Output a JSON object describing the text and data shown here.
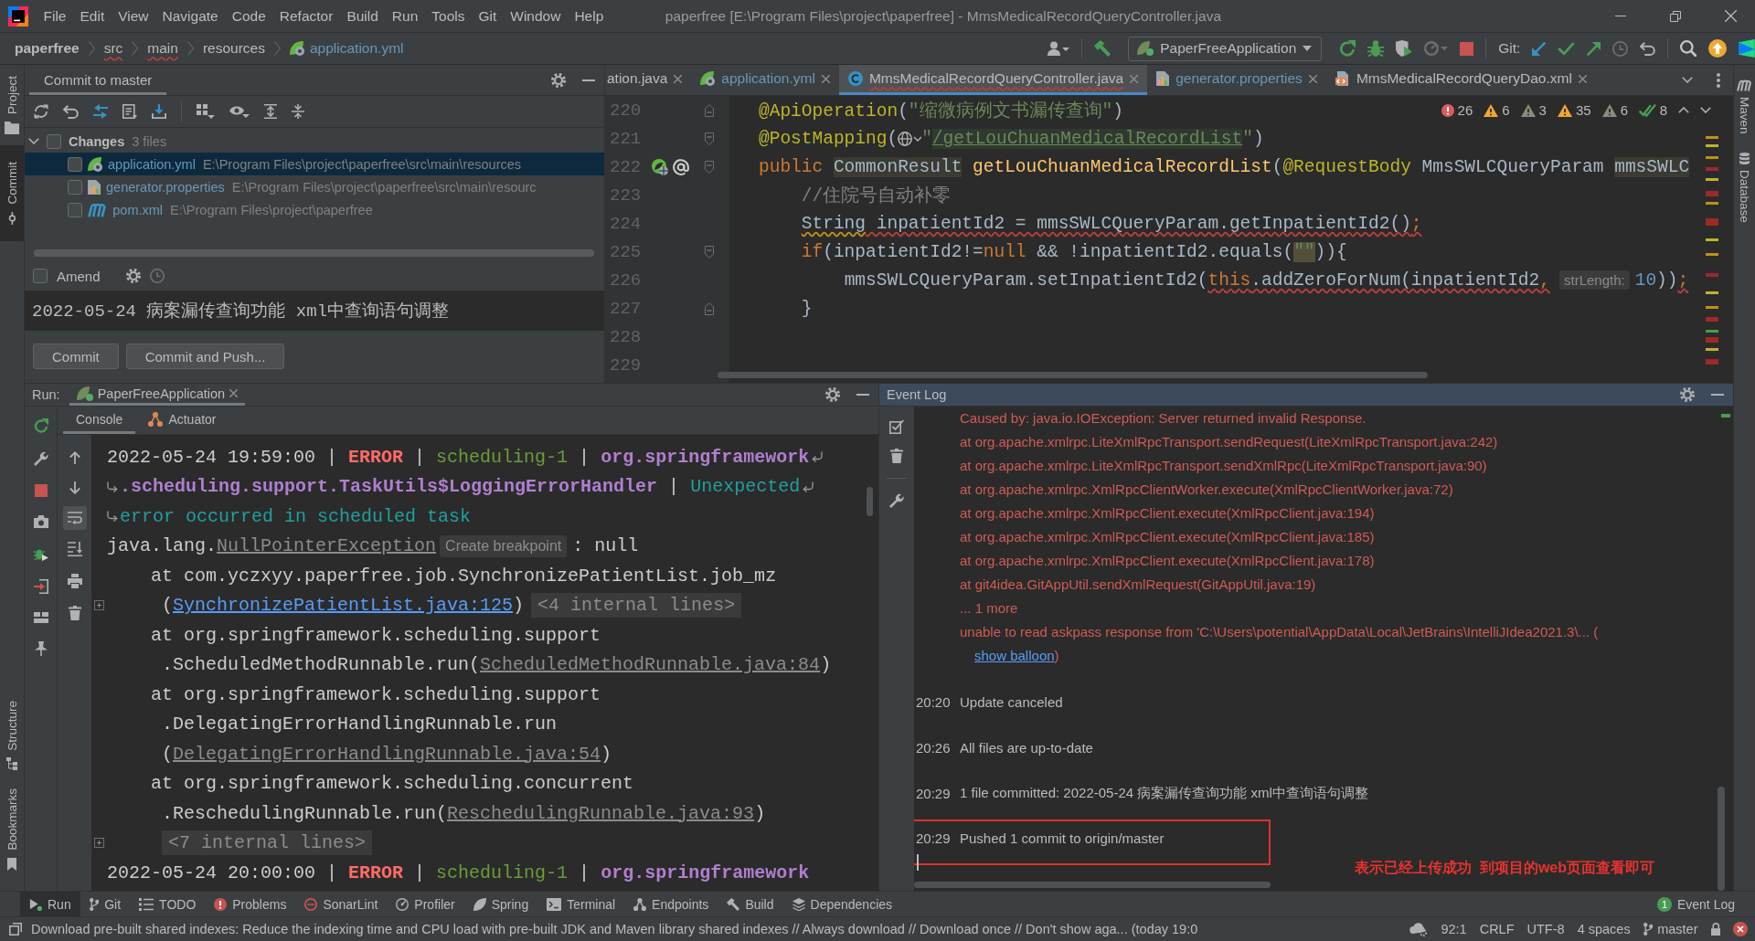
{
  "title_bar": {
    "menu": [
      "File",
      "Edit",
      "View",
      "Navigate",
      "Code",
      "Refactor",
      "Build",
      "Run",
      "Tools",
      "Git",
      "Window",
      "Help"
    ],
    "title": "paperfree [E:\\Program Files\\project\\paperfree] - MmsMedicalRecordQueryController.java"
  },
  "navigation_bar": {
    "breadcrumbs": [
      {
        "label": "paperfree",
        "kind": "project",
        "errors": false
      },
      {
        "label": "src",
        "kind": "folder",
        "errors": true
      },
      {
        "label": "main",
        "kind": "folder",
        "errors": true
      },
      {
        "label": "resources",
        "kind": "folder",
        "errors": false
      },
      {
        "label": "application.yml",
        "kind": "yaml",
        "errors": false
      }
    ],
    "run_configuration": "PaperFreeApplication",
    "git_label": "Git:"
  },
  "tool_strip": {
    "top": [
      {
        "label": "Project",
        "kind": "project",
        "selected": false
      },
      {
        "label": "Commit",
        "kind": "commit",
        "selected": true
      }
    ],
    "bottom": [
      {
        "label": "Structure",
        "kind": "structure",
        "selected": false
      },
      {
        "label": "Bookmarks",
        "kind": "bookmarks",
        "selected": false
      }
    ]
  },
  "right_strip": [
    {
      "label": "Maven",
      "kind": "maven"
    },
    {
      "label": "Database",
      "kind": "database"
    }
  ],
  "commit_panel": {
    "title": "Commit to master",
    "changes": {
      "label": "Changes",
      "count": "3 files",
      "expanded": true,
      "checked": false,
      "files": [
        {
          "name": "application.yml",
          "path": "E:\\Program Files\\project\\paperfree\\src\\main\\resources",
          "kind": "yaml",
          "checked": false,
          "selected": true
        },
        {
          "name": "generator.properties",
          "path": "E:\\Program Files\\project\\paperfree\\src\\main\\resourc",
          "kind": "properties",
          "checked": false,
          "selected": false
        },
        {
          "name": "pom.xml",
          "path": "E:\\Program Files\\project\\paperfree",
          "kind": "maven",
          "checked": false,
          "selected": false
        }
      ]
    },
    "amend": {
      "label": "Amend",
      "checked": false
    },
    "message": "2022-05-24 病案漏传查询功能 xml中查询语句调整",
    "buttons": [
      "Commit",
      "Commit and Push..."
    ]
  },
  "editor": {
    "tabs": [
      {
        "label": "ation.java",
        "kind": "plain",
        "selected": false,
        "modified": false,
        "errors": false
      },
      {
        "label": "application.yml",
        "kind": "yaml",
        "selected": false,
        "modified": true,
        "errors": false
      },
      {
        "label": "MmsMedicalRecordQueryController.java",
        "kind": "class",
        "selected": true,
        "modified": false,
        "errors": true
      },
      {
        "label": "generator.properties",
        "kind": "properties",
        "selected": false,
        "modified": true,
        "errors": false
      },
      {
        "label": "MmsMedicalRecordQueryDao.xml",
        "kind": "xml",
        "selected": false,
        "modified": false,
        "errors": false
      }
    ],
    "inspections": [
      {
        "kind": "error",
        "count": "26"
      },
      {
        "kind": "warning",
        "count": "6"
      },
      {
        "kind": "weak",
        "count": "3"
      },
      {
        "kind": "warning",
        "count": "35"
      },
      {
        "kind": "weak",
        "count": "6"
      },
      {
        "kind": "ok",
        "count": "8"
      }
    ],
    "lines": [
      {
        "number": "220",
        "fold": {
          "kind": "end"
        },
        "tokens": [
          {
            "text": "@ApiOperation",
            "kind": "annotation"
          },
          {
            "text": "(",
            "kind": "plain"
          },
          {
            "text": "\"缩微病例文书漏传查询\"",
            "kind": "string"
          },
          {
            "text": ")",
            "kind": "plain"
          }
        ]
      },
      {
        "number": "221",
        "fold": {
          "kind": "start"
        },
        "tokens": [
          {
            "text": "@PostMapping",
            "kind": "annotation"
          },
          {
            "text": "(",
            "kind": "plain"
          },
          {
            "kind": "endpoint-inlay"
          },
          {
            "text": "\"",
            "kind": "string"
          },
          {
            "text": "/getLouChuanMedicalRecordList",
            "kind": "url"
          },
          {
            "text": "\"",
            "kind": "string"
          },
          {
            "text": ")",
            "kind": "plain"
          }
        ]
      },
      {
        "number": "222",
        "fold": {
          "kind": "start"
        },
        "gutter": [
          {
            "kind": "web-bean"
          },
          {
            "kind": "implements"
          }
        ],
        "tokens": [
          {
            "text": "public ",
            "kind": "keyword"
          },
          {
            "text": "CommonResult",
            "kind": "type-highlight"
          },
          {
            "text": " getLouChuanMedicalRecordList",
            "kind": "method"
          },
          {
            "text": "(",
            "kind": "plain"
          },
          {
            "text": "@RequestBody",
            "kind": "annotation"
          },
          {
            "text": " MmsSWLCQueryParam ",
            "kind": "plain"
          },
          {
            "text": "mmsSWLC",
            "kind": "param-highlight"
          }
        ]
      },
      {
        "number": "223",
        "tokens": [
          {
            "text": "    //住院号自动补零",
            "kind": "comment"
          }
        ]
      },
      {
        "number": "224",
        "tokens": [
          {
            "text": "    String",
            "kind": "plain",
            "underline": {
              "kind": "warning"
            }
          },
          {
            "text": " inpatientId2 = mmsSWLCQueryParam.getInpatientId2()",
            "kind": "plain",
            "underline": {
              "kind": "error"
            }
          },
          {
            "text": ";",
            "kind": "keyword",
            "underline": {
              "kind": "error"
            }
          }
        ]
      },
      {
        "number": "225",
        "fold": {
          "kind": "start"
        },
        "tokens": [
          {
            "text": "    if",
            "kind": "keyword"
          },
          {
            "text": "(inpatientId2!=",
            "kind": "plain"
          },
          {
            "text": "null",
            "kind": "keyword"
          },
          {
            "text": " && !inpatientId2.equals(",
            "kind": "plain"
          },
          {
            "text": "\"\"",
            "kind": "string-highlight"
          },
          {
            "text": ")){",
            "kind": "plain"
          }
        ]
      },
      {
        "number": "226",
        "tokens": [
          {
            "text": "        mmsSWLCQueryParam.setInpatientId2(",
            "kind": "plain"
          },
          {
            "text": "this",
            "kind": "keyword",
            "underline": {
              "kind": "error"
            }
          },
          {
            "text": ".addZeroForNum(inpatientId2",
            "kind": "plain",
            "underline": {
              "kind": "error"
            }
          },
          {
            "text": ",",
            "kind": "keyword",
            "underline": {
              "kind": "error"
            }
          },
          {
            "text": "strLength:",
            "kind": "hint"
          },
          {
            "text": "10",
            "kind": "number"
          },
          {
            "text": "))",
            "kind": "plain"
          },
          {
            "text": ";",
            "kind": "keyword",
            "underline": {
              "kind": "error"
            }
          }
        ]
      },
      {
        "number": "227",
        "fold": {
          "kind": "end"
        },
        "tokens": [
          {
            "text": "    }",
            "kind": "plain"
          }
        ]
      },
      {
        "number": "228"
      },
      {
        "number": "229"
      }
    ]
  },
  "run_panel": {
    "label": "Run:",
    "tabs": [
      {
        "label": "PaperFreeApplication",
        "selected": true
      }
    ],
    "subtabs": [
      {
        "label": "Console",
        "kind": "console",
        "selected": true
      },
      {
        "label": "Actuator",
        "kind": "actuator",
        "selected": false
      }
    ],
    "soft_wrap": true,
    "lines": [
      {
        "wrap_in": false,
        "wrap_out": true,
        "fold": false,
        "continuation": false,
        "tokens": [
          {
            "text": "2022-05-24 19:59:00 | ",
            "kind": "plain"
          },
          {
            "text": "ERROR",
            "kind": "level"
          },
          {
            "text": " | ",
            "kind": "plain"
          },
          {
            "text": "scheduling-1",
            "kind": "thread"
          },
          {
            "text": " | ",
            "kind": "plain"
          },
          {
            "text": "org.springframework",
            "kind": "logger"
          }
        ]
      },
      {
        "wrap_in": true,
        "wrap_out": true,
        "fold": false,
        "continuation": false,
        "tokens": [
          {
            "text": ".scheduling.support.TaskUtils$LoggingErrorHandler",
            "kind": "logger"
          },
          {
            "text": " | ",
            "kind": "plain"
          },
          {
            "text": "Unexpected",
            "kind": "message"
          }
        ]
      },
      {
        "wrap_in": true,
        "wrap_out": false,
        "fold": false,
        "continuation": false,
        "tokens": [
          {
            "text": "error occurred in scheduled task",
            "kind": "message"
          }
        ]
      },
      {
        "wrap_in": false,
        "wrap_out": false,
        "fold": false,
        "continuation": false,
        "tokens": [
          {
            "text": "java.lang.",
            "kind": "plain"
          },
          {
            "text": "NullPointerException",
            "kind": "link-muted"
          },
          {
            "text": "Create breakpoint",
            "kind": "hint"
          },
          {
            "text": ": null",
            "kind": "plain"
          }
        ]
      },
      {
        "wrap_in": false,
        "wrap_out": false,
        "fold": false,
        "continuation": false,
        "tokens": [
          {
            "text": "    at com.yczxyy.paperfree.job.SynchronizePatientList.job_mz",
            "kind": "plain"
          }
        ]
      },
      {
        "wrap_in": false,
        "wrap_out": false,
        "fold": true,
        "continuation": true,
        "tokens": [
          {
            "text": "(",
            "kind": "plain"
          },
          {
            "text": "SynchronizePatientList.java:125",
            "kind": "link"
          },
          {
            "text": ")",
            "kind": "plain"
          },
          {
            "text": "<4 internal lines>",
            "kind": "folded"
          }
        ]
      },
      {
        "wrap_in": false,
        "wrap_out": false,
        "fold": false,
        "continuation": false,
        "tokens": [
          {
            "text": "    at org.springframework.scheduling.support",
            "kind": "plain"
          }
        ]
      },
      {
        "wrap_in": false,
        "wrap_out": false,
        "fold": false,
        "continuation": true,
        "tokens": [
          {
            "text": ".ScheduledMethodRunnable.run(",
            "kind": "plain"
          },
          {
            "text": "ScheduledMethodRunnable.java:84",
            "kind": "link-muted"
          },
          {
            "text": ")",
            "kind": "plain"
          }
        ]
      },
      {
        "wrap_in": false,
        "wrap_out": false,
        "fold": false,
        "continuation": false,
        "tokens": [
          {
            "text": "    at org.springframework.scheduling.support",
            "kind": "plain"
          }
        ]
      },
      {
        "wrap_in": false,
        "wrap_out": false,
        "fold": false,
        "continuation": true,
        "tokens": [
          {
            "text": ".DelegatingErrorHandlingRunnable.run",
            "kind": "plain"
          }
        ]
      },
      {
        "wrap_in": false,
        "wrap_out": false,
        "fold": false,
        "continuation": true,
        "tokens": [
          {
            "text": "(",
            "kind": "plain"
          },
          {
            "text": "DelegatingErrorHandlingRunnable.java:54",
            "kind": "link-muted"
          },
          {
            "text": ")",
            "kind": "plain"
          }
        ]
      },
      {
        "wrap_in": false,
        "wrap_out": false,
        "fold": false,
        "continuation": false,
        "tokens": [
          {
            "text": "    at org.springframework.scheduling.concurrent",
            "kind": "plain"
          }
        ]
      },
      {
        "wrap_in": false,
        "wrap_out": false,
        "fold": false,
        "continuation": true,
        "tokens": [
          {
            "text": ".ReschedulingRunnable.run(",
            "kind": "plain"
          },
          {
            "text": "ReschedulingRunnable.java:93",
            "kind": "link-muted"
          },
          {
            "text": ")",
            "kind": "plain"
          }
        ]
      },
      {
        "wrap_in": false,
        "wrap_out": false,
        "fold": true,
        "continuation": true,
        "tokens": [
          {
            "text": "<7 internal lines>",
            "kind": "folded"
          }
        ]
      },
      {
        "wrap_in": false,
        "wrap_out": false,
        "fold": false,
        "continuation": false,
        "tokens": [
          {
            "text": "2022-05-24 20:00:00 | ",
            "kind": "plain"
          },
          {
            "text": "ERROR",
            "kind": "level"
          },
          {
            "text": " | ",
            "kind": "plain"
          },
          {
            "text": "scheduling-1",
            "kind": "thread"
          },
          {
            "text": " | ",
            "kind": "plain"
          },
          {
            "text": "org.springframework",
            "kind": "logger"
          }
        ]
      }
    ]
  },
  "event_log": {
    "title": "Event Log",
    "trace": [
      "Caused by: java.io.IOException: Server returned invalid Response.",
      "at org.apache.xmlrpc.LiteXmlRpcTransport.sendRequest(LiteXmlRpcTransport.java:242)",
      "at org.apache.xmlrpc.LiteXmlRpcTransport.sendXmlRpc(LiteXmlRpcTransport.java:90)",
      "at org.apache.xmlrpc.XmlRpcClientWorker.execute(XmlRpcClientWorker.java:72)",
      "at org.apache.xmlrpc.XmlRpcClient.execute(XmlRpcClient.java:194)",
      "at org.apache.xmlrpc.XmlRpcClient.execute(XmlRpcClient.java:185)",
      "at org.apache.xmlrpc.XmlRpcClient.execute(XmlRpcClient.java:178)",
      "at git4idea.GitAppUtil.sendXmlRequest(GitAppUtil.java:19)",
      "... 1 more"
    ],
    "trace_tail": {
      "text": "unable to read askpass response from 'C:\\Users\\potential\\AppData\\Local\\JetBrains\\IntelliJIdea2021.3\\... (",
      "link": "show balloon",
      "close": ")"
    },
    "entries": [
      {
        "time": "20:20",
        "text": "Update canceled",
        "highlighted": false
      },
      {
        "time": "20:26",
        "text": "All files are up-to-date",
        "highlighted": false
      },
      {
        "time": "20:29",
        "text": "1 file committed: 2022-05-24 病案漏传查询功能 xml中查询语句调整",
        "highlighted": false
      },
      {
        "time": "20:29",
        "text": "Pushed 1 commit to origin/master",
        "highlighted": true
      }
    ],
    "note": "表示已经上传成功  到项目的web页面查看即可"
  },
  "tool_windows": [
    {
      "label": "Run",
      "kind": "run",
      "selected": true
    },
    {
      "label": "Git",
      "kind": "git",
      "selected": false
    },
    {
      "label": "TODO",
      "kind": "todo",
      "selected": false
    },
    {
      "label": "Problems",
      "kind": "problems",
      "selected": false
    },
    {
      "label": "SonarLint",
      "kind": "sonarlint",
      "selected": false
    },
    {
      "label": "Profiler",
      "kind": "profiler",
      "selected": false
    },
    {
      "label": "Spring",
      "kind": "spring",
      "selected": false
    },
    {
      "label": "Terminal",
      "kind": "terminal",
      "selected": false
    },
    {
      "label": "Endpoints",
      "kind": "endpoints",
      "selected": false
    },
    {
      "label": "Build",
      "kind": "build",
      "selected": false
    },
    {
      "label": "Dependencies",
      "kind": "dependencies",
      "selected": false
    }
  ],
  "event_log_button": {
    "label": "Event Log",
    "badge": "1"
  },
  "status_bar": {
    "message": "Download pre-built shared indexes: Reduce the indexing time and CPU load with pre-built JDK and Maven library shared indexes // Always download // Download once // Don't show aga... (today 19:0",
    "position": "92:1",
    "line_separator": "CRLF",
    "encoding": "UTF-8",
    "indent": "4 spaces",
    "branch": "master"
  }
}
